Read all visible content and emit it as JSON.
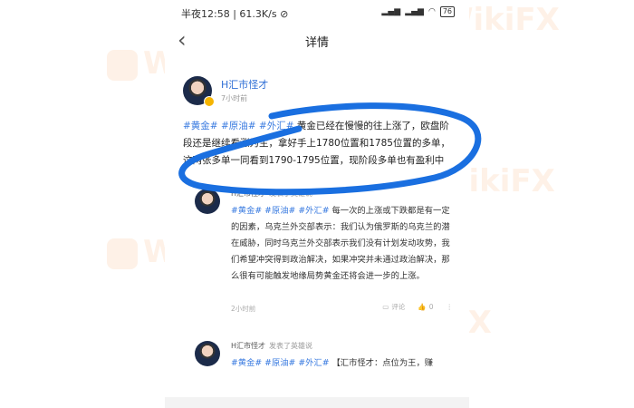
{
  "status_bar": {
    "time": "半夜12:58",
    "speed": "61.3K/s",
    "battery": "76"
  },
  "header": {
    "title": "详情"
  },
  "post": {
    "author": "H汇市怪才",
    "time": "7小时前",
    "tags": [
      "#黄金#",
      "#原油#",
      "#外汇#"
    ],
    "text": "黄金已经在慢慢的往上涨了，欧盘阶段还是继续看涨为主，拿好手上1780位置和1785位置的多单，这两张多单一同看到1790-1795位置，现阶段多单也有盈利中"
  },
  "comments": [
    {
      "author": "H汇市怪才",
      "subtitle": "发表了英雄说",
      "tags": [
        "#黄金#",
        "#原油#",
        "#外汇#"
      ],
      "text": "每一次的上涨或下跌都是有一定的因素，乌克兰外交部表示：我们认为俄罗斯的乌克兰的潜在威胁，同时乌克兰外交部表示我们没有计划发动攻势，我们希望冲突得到政治解决，如果冲突并未通过政治解决，那么很有可能触发地缘局势黄金还将会进一步的上涨。",
      "time": "2小时前",
      "comment_label": "评论",
      "like_count": "0"
    },
    {
      "author": "H汇市怪才",
      "subtitle": "发表了英雄说",
      "tags": [
        "#黄金#",
        "#原油#",
        "#外汇#"
      ],
      "text": "【汇市怪才：点位为王，赚"
    }
  ],
  "watermark": "WikiFX",
  "colors": {
    "link": "#3a7be0",
    "annotation": "#1a6fe0",
    "badge": "#f5b400"
  }
}
